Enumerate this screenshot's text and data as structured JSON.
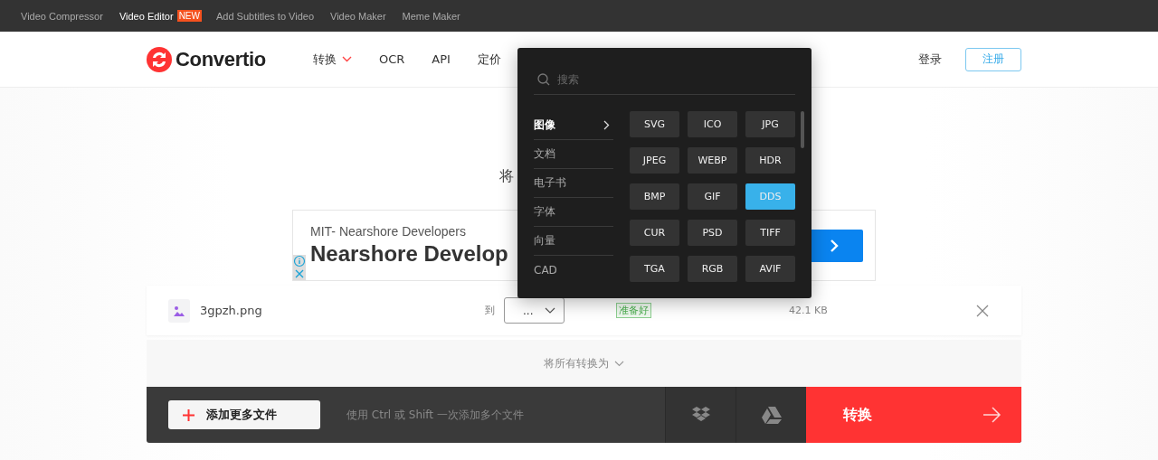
{
  "top_bar": {
    "links": [
      {
        "label": "Video Compressor",
        "selected": false
      },
      {
        "label": "Video Editor",
        "selected": true,
        "badge": "NEW"
      },
      {
        "label": "Add Subtitles to Video",
        "selected": false
      },
      {
        "label": "Video Maker",
        "selected": false
      },
      {
        "label": "Meme Maker",
        "selected": false
      }
    ]
  },
  "header": {
    "logo": "Convertio",
    "nav": [
      {
        "label": "转换",
        "dropdown": true
      },
      {
        "label": "OCR",
        "dropdown": false
      },
      {
        "label": "API",
        "dropdown": false
      },
      {
        "label": "定价",
        "dropdown": false
      }
    ],
    "login": "登录",
    "signup": "注册"
  },
  "heading": "将",
  "ad": {
    "subtitle": "MIT- Nearshore Developers",
    "title": "Nearshore Develop"
  },
  "file": {
    "name": "3gpzh.png",
    "to": "到",
    "format": "...",
    "status": "准备好",
    "size": "42.1 KB"
  },
  "convert_all": "将所有转换为",
  "action_bar": {
    "add_button": "添加更多文件",
    "hint": "使用 Ctrl 或 Shift 一次添加多个文件",
    "convert_button": "转换"
  },
  "format_menu": {
    "search_placeholder": "搜索",
    "categories": [
      {
        "label": "图像",
        "selected": true
      },
      {
        "label": "文档",
        "selected": false
      },
      {
        "label": "电子书",
        "selected": false
      },
      {
        "label": "字体",
        "selected": false
      },
      {
        "label": "向量",
        "selected": false
      },
      {
        "label": "CAD",
        "selected": false
      }
    ],
    "formats": [
      {
        "label": "SVG",
        "selected": false
      },
      {
        "label": "ICO",
        "selected": false
      },
      {
        "label": "JPG",
        "selected": false
      },
      {
        "label": "JPEG",
        "selected": false
      },
      {
        "label": "WEBP",
        "selected": false
      },
      {
        "label": "HDR",
        "selected": false
      },
      {
        "label": "BMP",
        "selected": false
      },
      {
        "label": "GIF",
        "selected": false
      },
      {
        "label": "DDS",
        "selected": true
      },
      {
        "label": "CUR",
        "selected": false
      },
      {
        "label": "PSD",
        "selected": false
      },
      {
        "label": "TIFF",
        "selected": false
      },
      {
        "label": "TGA",
        "selected": false
      },
      {
        "label": "RGB",
        "selected": false
      },
      {
        "label": "AVIF",
        "selected": false
      }
    ]
  }
}
